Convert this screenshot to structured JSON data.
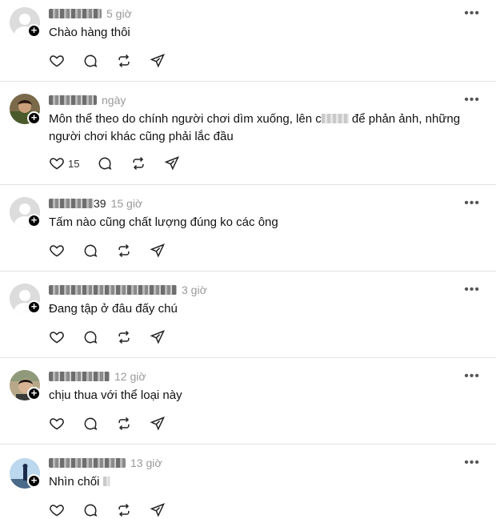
{
  "posts": [
    {
      "time": "5 giờ",
      "text": "Chào hàng thôi",
      "likes": ""
    },
    {
      "time": "ngày",
      "text_before": "Môn thể theo do chính người chơi dìm xuống, lên c",
      "text_after": " để phản ảnh, những người chơi khác cũng phải lắc đầu",
      "likes": "15"
    },
    {
      "username_suffix": "39",
      "time": "15 giờ",
      "text": "Tấm nào cũng chất lượng đúng ko các ông",
      "likes": ""
    },
    {
      "time": "3 giờ",
      "text": "Đang tập ở đâu đấy chú",
      "likes": ""
    },
    {
      "time": "12 giờ",
      "text": "chịu thua với thể loại này",
      "likes": ""
    },
    {
      "time": "13 giờ",
      "text": "Nhìn chối",
      "likes": ""
    }
  ],
  "icons": {
    "more": "more-horizontal-icon",
    "like": "heart-icon",
    "comment": "comment-icon",
    "repost": "repost-icon",
    "share": "share-icon",
    "follow": "plus-icon"
  }
}
